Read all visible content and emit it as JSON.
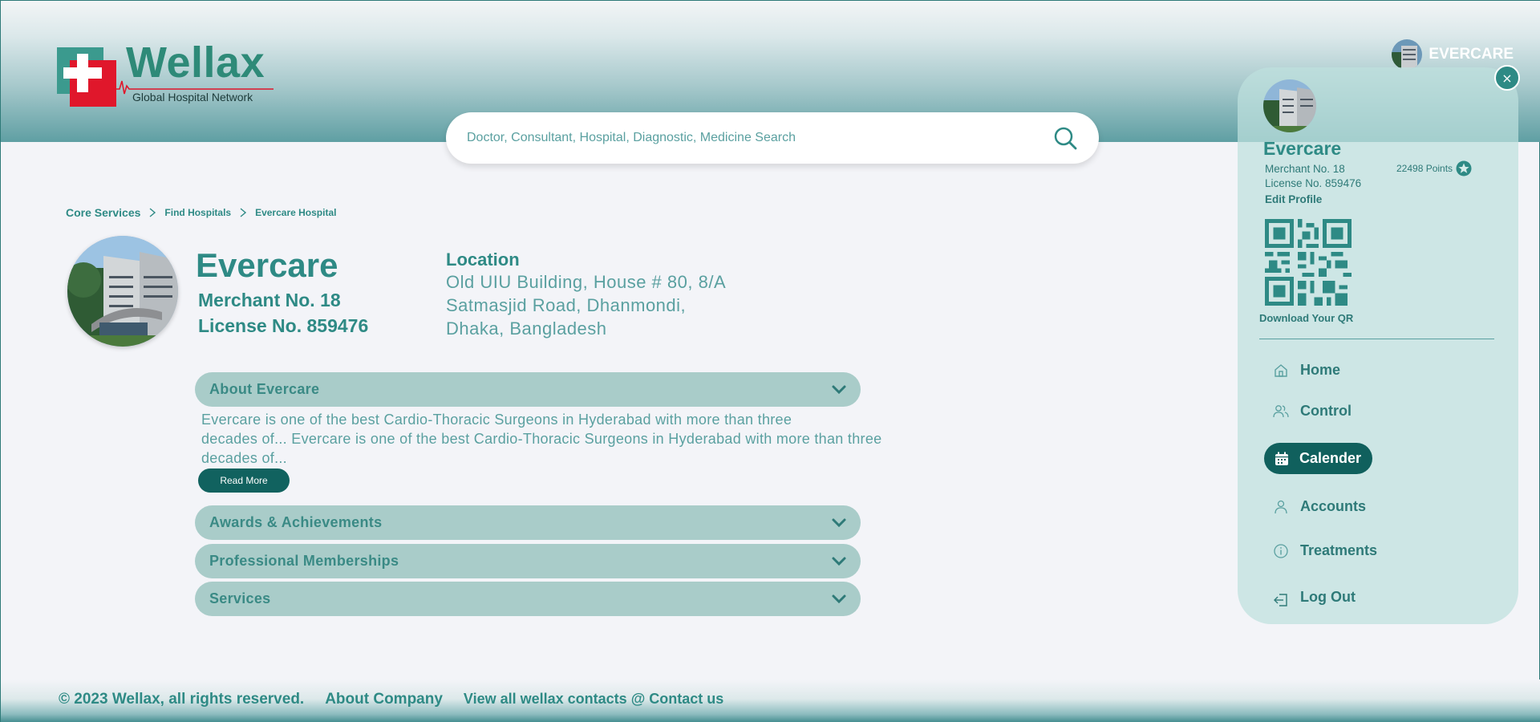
{
  "header": {
    "logo_name": "Wellax",
    "logo_tagline": "Global Hospital Network",
    "user_name": "EVERCARE"
  },
  "search": {
    "placeholder": "Doctor, Consultant, Hospital, Diagnostic, Medicine Search"
  },
  "breadcrumb": [
    "Core Services",
    "Find Hospitals",
    "Evercare Hospital"
  ],
  "profile": {
    "name": "Evercare",
    "merchant": "Merchant No. 18",
    "license": "License No. 859476"
  },
  "location": {
    "title": "Location",
    "lines": [
      "Old UIU Building, House # 80, 8/A",
      "Satmasjid Road, Dhanmondi,",
      "Dhaka, Bangladesh"
    ]
  },
  "sections": [
    {
      "label": "About Evercare",
      "expanded": true
    },
    {
      "label": "Awards & Achievements",
      "expanded": false
    },
    {
      "label": "Professional Memberships",
      "expanded": false
    },
    {
      "label": "Services",
      "expanded": false
    }
  ],
  "about": {
    "lines": [
      "Evercare is one of the best Cardio-Thoracic Surgeons in Hyderabad with more than three",
      "decades of... Evercare is one of the best Cardio-Thoracic Surgeons in Hyderabad with more than three",
      "decades of..."
    ],
    "read_more": "Read More"
  },
  "footer": {
    "copyright": "© 2023 Wellax, all rights reserved.",
    "about_company": "About Company",
    "contacts": "View all wellax contacts @ Contact us"
  },
  "panel": {
    "close": "×",
    "name": "Evercare",
    "merchant": "Merchant No. 18",
    "license": "License No. 859476",
    "points": "22498 Points",
    "edit_profile": "Edit Profile",
    "download_qr": "Download Your QR",
    "menu": [
      {
        "label": "Home",
        "icon": "home-icon",
        "active": false
      },
      {
        "label": "Control",
        "icon": "users-icon",
        "active": false
      },
      {
        "label": "Calender",
        "icon": "calendar-icon",
        "active": true
      },
      {
        "label": "Accounts",
        "icon": "user-icon",
        "active": false
      },
      {
        "label": "Treatments",
        "icon": "info-icon",
        "active": false
      },
      {
        "label": "Log Out",
        "icon": "logout-icon",
        "active": false
      }
    ]
  },
  "colors": {
    "brand_teal": "#2e8a85",
    "accordion_bg": "#a9ccc9",
    "active_menu": "#10605d",
    "logo_red": "#e0172b"
  }
}
